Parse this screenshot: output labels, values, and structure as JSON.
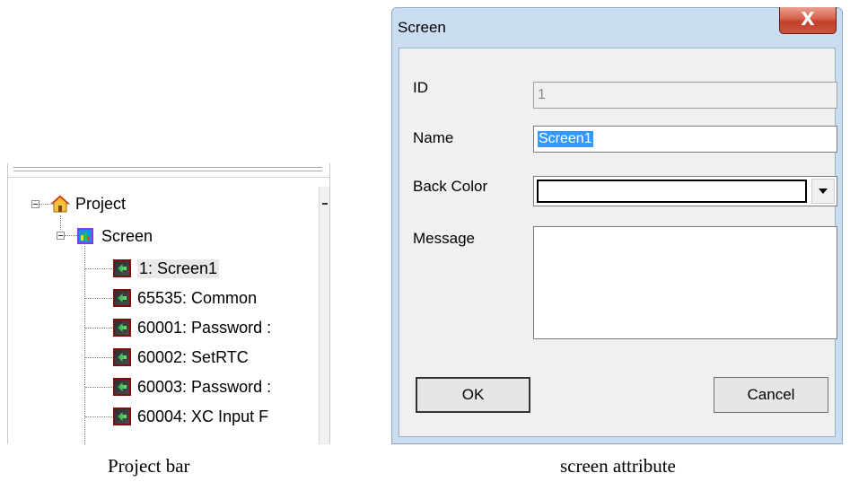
{
  "project_bar": {
    "tree": {
      "root_label": "Project",
      "screen_folder_label": "Screen",
      "items": [
        {
          "label": "1: Screen1",
          "selected": true
        },
        {
          "label": "65535: Common"
        },
        {
          "label": "60001: Password :"
        },
        {
          "label": "60002: SetRTC"
        },
        {
          "label": "60003: Password :"
        },
        {
          "label": "60004: XC Input F"
        }
      ]
    },
    "caption": "Project bar"
  },
  "dialog": {
    "title": "Screen",
    "close_glyph": "X",
    "fields": {
      "id": {
        "label": "ID",
        "value": "1"
      },
      "name": {
        "label": "Name",
        "value": "Screen1"
      },
      "back_color": {
        "label": "Back Color",
        "value_color": "#ffffff"
      },
      "message": {
        "label": "Message",
        "value": ""
      }
    },
    "buttons": {
      "ok": "OK",
      "cancel": "Cancel"
    },
    "caption": "screen attribute"
  },
  "colors": {
    "dialog_frame": "#c9dcf0",
    "close_button": "#c2402a",
    "selection_highlight": "#3399ff",
    "screen_icon_border": "#7a1010"
  }
}
